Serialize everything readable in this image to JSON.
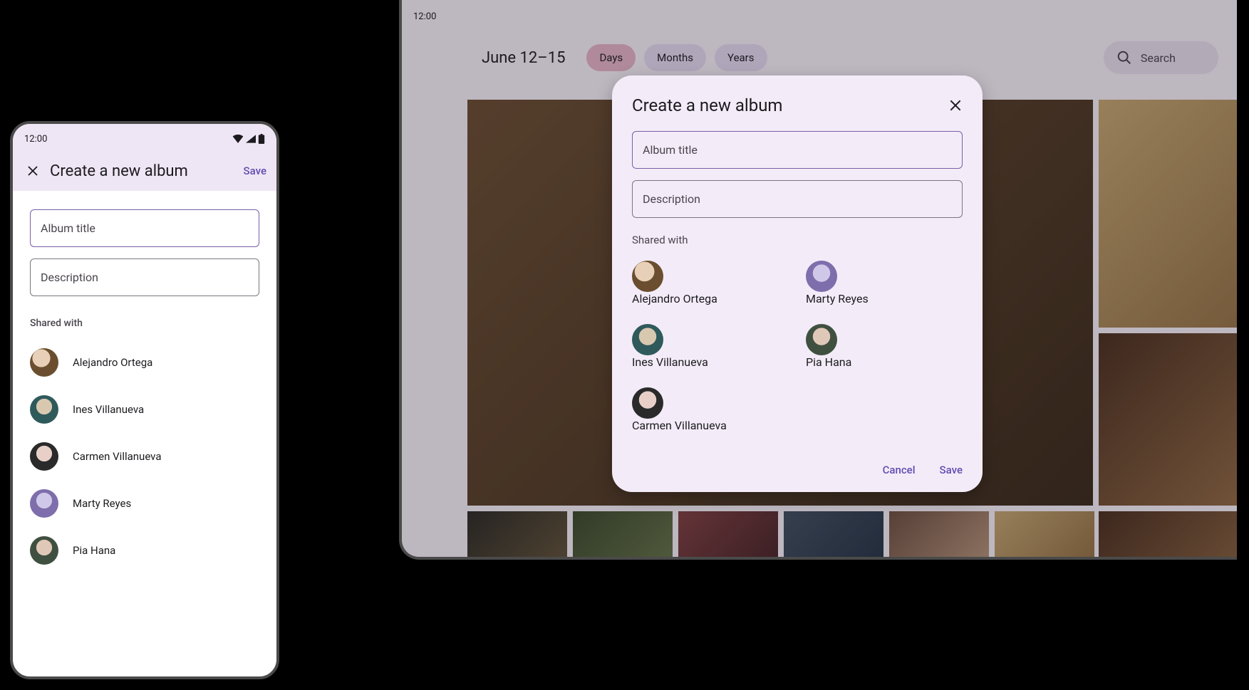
{
  "phone": {
    "clock": "12:00",
    "title": "Create a new album",
    "save": "Save",
    "album_title_ph": "Album title",
    "description_ph": "Description",
    "shared_label": "Shared with",
    "people": [
      {
        "name": "Alejandro Ortega"
      },
      {
        "name": "Ines Villanueva"
      },
      {
        "name": "Carmen Villanueva"
      },
      {
        "name": "Marty Reyes"
      },
      {
        "name": "Pia Hana"
      }
    ]
  },
  "tablet": {
    "clock": "12:00",
    "date_range": "June 12–15",
    "chips": {
      "days": "Days",
      "months": "Months",
      "years": "Years"
    },
    "search_ph": "Search",
    "dialog": {
      "title": "Create a new album",
      "album_title_ph": "Album title",
      "description_ph": "Description",
      "shared_label": "Shared with",
      "people": [
        {
          "name": "Alejandro Ortega"
        },
        {
          "name": "Marty Reyes"
        },
        {
          "name": "Ines Villanueva"
        },
        {
          "name": "Pia Hana"
        },
        {
          "name": "Carmen Villanueva"
        }
      ],
      "cancel": "Cancel",
      "save": "Save"
    }
  }
}
